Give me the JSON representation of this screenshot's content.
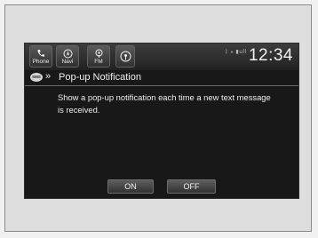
{
  "nav": {
    "phone_label": "Phone",
    "navi_label": "Navi",
    "fm_label": "FM"
  },
  "status": {
    "icons_text": "ᛒ ⁎ ▮ull",
    "clock": "12:34"
  },
  "header": {
    "sms_badge": "SMS",
    "chevron": "»",
    "title": "Pop-up Notification"
  },
  "content": {
    "message": "Show a pop-up notification each time a new text message is received."
  },
  "options": {
    "on_label": "ON",
    "off_label": "OFF"
  },
  "colors": {
    "screen_bg": "#181818",
    "text": "#eeeeee"
  }
}
